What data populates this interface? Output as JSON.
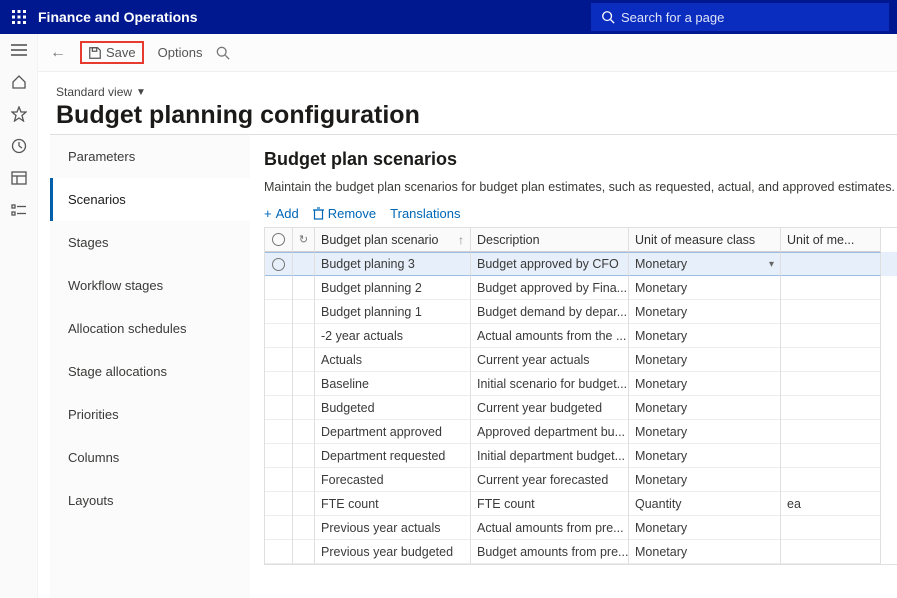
{
  "app": {
    "title": "Finance and Operations",
    "search_placeholder": "Search for a page"
  },
  "actions": {
    "save": "Save",
    "options": "Options"
  },
  "heading": {
    "view": "Standard view",
    "title": "Budget planning configuration"
  },
  "sidenav": {
    "items": [
      "Parameters",
      "Scenarios",
      "Stages",
      "Workflow stages",
      "Allocation schedules",
      "Stage allocations",
      "Priorities",
      "Columns",
      "Layouts"
    ],
    "active_index": 1
  },
  "panel": {
    "title": "Budget plan scenarios",
    "desc": "Maintain the budget plan scenarios for budget plan estimates, such as requested, actual, and approved estimates.",
    "toolbar": {
      "add": "Add",
      "remove": "Remove",
      "translations": "Translations"
    },
    "columns": {
      "scenario": "Budget plan scenario",
      "description": "Description",
      "uom_class": "Unit of measure class",
      "uom": "Unit of me..."
    },
    "selected_index": 0,
    "rows": [
      {
        "scn": "Budget planing 3",
        "desc": "Budget approved by CFO",
        "uomc": "Monetary",
        "uom": ""
      },
      {
        "scn": "Budget planning 2",
        "desc": "Budget approved by Fina...",
        "uomc": "Monetary",
        "uom": ""
      },
      {
        "scn": "Budget planning 1",
        "desc": "Budget demand by depar...",
        "uomc": "Monetary",
        "uom": ""
      },
      {
        "scn": "-2 year actuals",
        "desc": "Actual amounts from the ...",
        "uomc": "Monetary",
        "uom": ""
      },
      {
        "scn": "Actuals",
        "desc": "Current year actuals",
        "uomc": "Monetary",
        "uom": ""
      },
      {
        "scn": "Baseline",
        "desc": "Initial scenario for budget...",
        "uomc": "Monetary",
        "uom": ""
      },
      {
        "scn": "Budgeted",
        "desc": "Current year budgeted",
        "uomc": "Monetary",
        "uom": ""
      },
      {
        "scn": "Department approved",
        "desc": "Approved department bu...",
        "uomc": "Monetary",
        "uom": ""
      },
      {
        "scn": "Department requested",
        "desc": "Initial department budget...",
        "uomc": "Monetary",
        "uom": ""
      },
      {
        "scn": "Forecasted",
        "desc": "Current year forecasted",
        "uomc": "Monetary",
        "uom": ""
      },
      {
        "scn": "FTE count",
        "desc": "FTE count",
        "uomc": "Quantity",
        "uom": "ea"
      },
      {
        "scn": "Previous year actuals",
        "desc": "Actual amounts from pre...",
        "uomc": "Monetary",
        "uom": ""
      },
      {
        "scn": "Previous year budgeted",
        "desc": "Budget amounts from pre...",
        "uomc": "Monetary",
        "uom": ""
      }
    ]
  }
}
